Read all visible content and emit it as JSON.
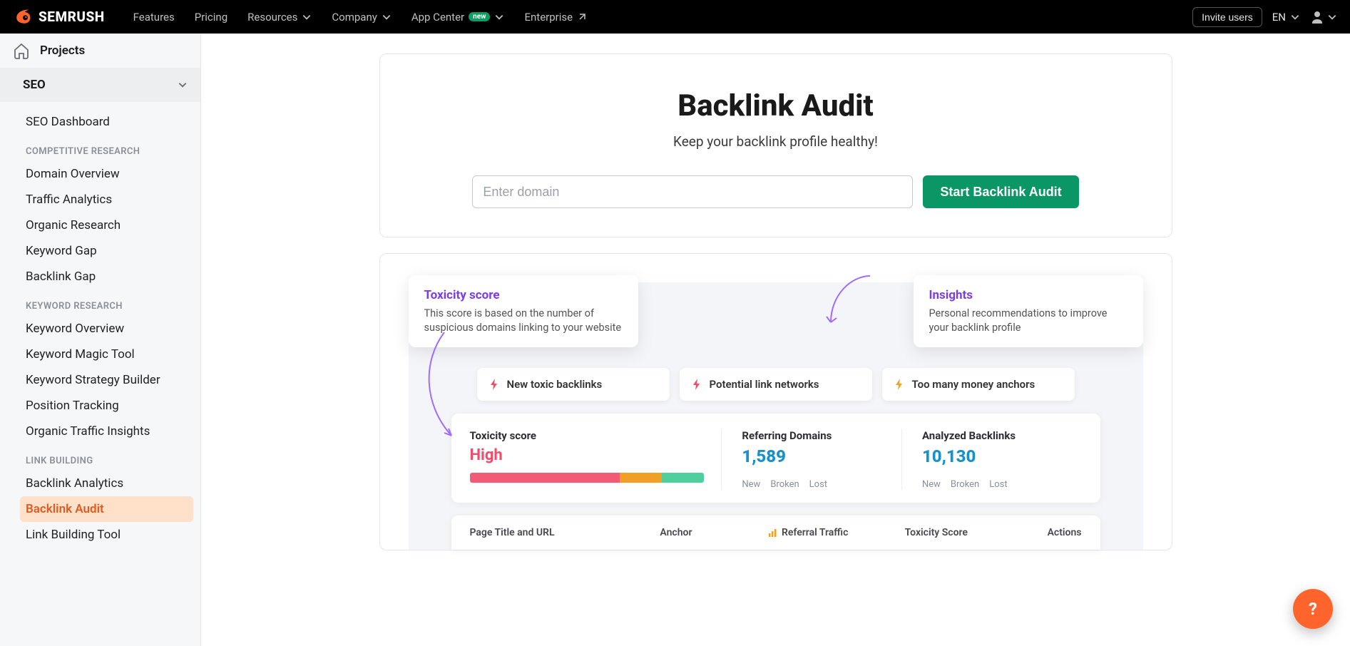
{
  "topnav": {
    "features": "Features",
    "pricing": "Pricing",
    "resources": "Resources",
    "company": "Company",
    "appcenter": "App Center",
    "appcenter_badge": "new",
    "enterprise": "Enterprise",
    "invite": "Invite users",
    "lang": "EN"
  },
  "sidebar": {
    "projects": "Projects",
    "seo": "SEO",
    "seo_dashboard": "SEO Dashboard",
    "group_competitive": "COMPETITIVE RESEARCH",
    "domain_overview": "Domain Overview",
    "traffic_analytics": "Traffic Analytics",
    "organic_research": "Organic Research",
    "keyword_gap": "Keyword Gap",
    "backlink_gap": "Backlink Gap",
    "group_keyword": "KEYWORD RESEARCH",
    "keyword_overview": "Keyword Overview",
    "keyword_magic": "Keyword Magic Tool",
    "keyword_strategy": "Keyword Strategy Builder",
    "position_tracking": "Position Tracking",
    "organic_traffic": "Organic Traffic Insights",
    "group_link": "LINK BUILDING",
    "backlink_analytics": "Backlink Analytics",
    "backlink_audit": "Backlink Audit",
    "link_building": "Link Building Tool"
  },
  "hero": {
    "title": "Backlink Audit",
    "subtitle": "Keep your backlink profile healthy!",
    "placeholder": "Enter domain",
    "cta": "Start Backlink Audit"
  },
  "tips": {
    "tox_title": "Toxicity score",
    "tox_desc": "This score is based on the number of suspicious domains linking to your website",
    "ins_title": "Insights",
    "ins_desc": "Personal recommendations to improve your backlink profile"
  },
  "chips": {
    "c1": "New toxic backlinks",
    "c2": "Potential link networks",
    "c3": "Too many money anchors"
  },
  "stats": {
    "tox_title": "Toxicity score",
    "tox_value": "High",
    "ref_title": "Referring Domains",
    "ref_value": "1,589",
    "ana_title": "Analyzed Backlinks",
    "ana_value": "10,130",
    "sub_new": "New",
    "sub_broken": "Broken",
    "sub_lost": "Lost"
  },
  "table": {
    "h1": "Page Title and URL",
    "h2": "Anchor",
    "h3": "Referral Traffic",
    "h4": "Toxicity Score",
    "h5": "Actions"
  }
}
